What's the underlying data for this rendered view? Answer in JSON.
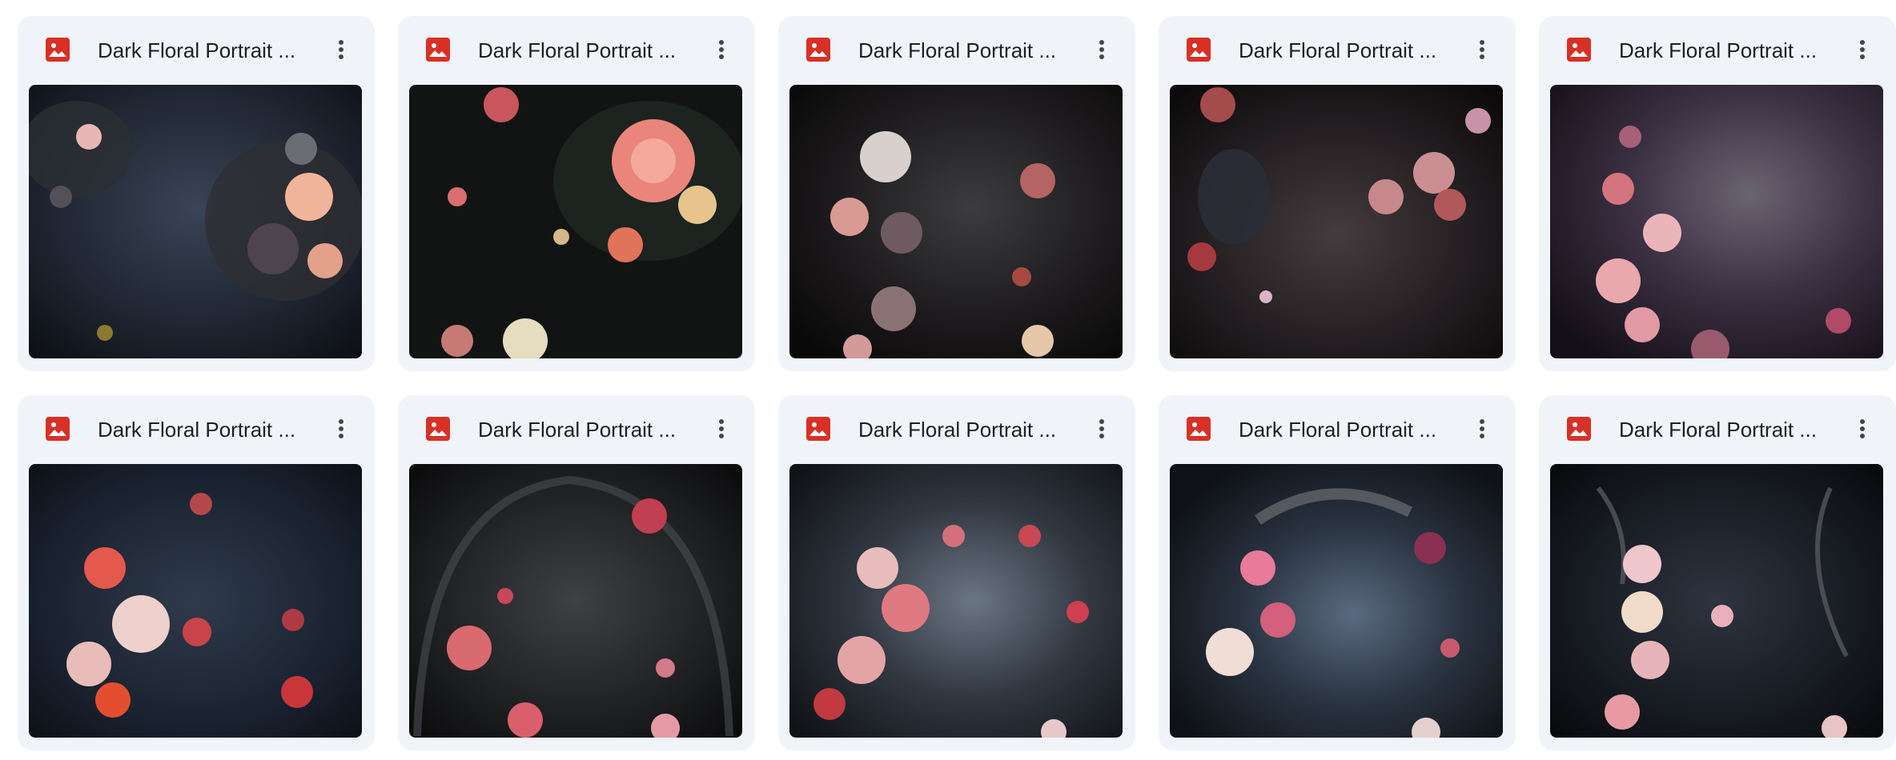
{
  "files": [
    {
      "title": "Dark Floral Portrait ...",
      "icon": "image-file-icon"
    },
    {
      "title": "Dark Floral Portrait ...",
      "icon": "image-file-icon"
    },
    {
      "title": "Dark Floral Portrait ...",
      "icon": "image-file-icon"
    },
    {
      "title": "Dark Floral Portrait ...",
      "icon": "image-file-icon"
    },
    {
      "title": "Dark Floral Portrait ...",
      "icon": "image-file-icon"
    },
    {
      "title": "Dark Floral Portrait ...",
      "icon": "image-file-icon"
    },
    {
      "title": "Dark Floral Portrait ...",
      "icon": "image-file-icon"
    },
    {
      "title": "Dark Floral Portrait ...",
      "icon": "image-file-icon"
    },
    {
      "title": "Dark Floral Portrait ...",
      "icon": "image-file-icon"
    },
    {
      "title": "Dark Floral Portrait ...",
      "icon": "image-file-icon"
    }
  ],
  "more_icon": "more-vert-icon",
  "colors": {
    "tile_bg": "#f0f4f9",
    "icon_red": "#d93025",
    "title_text": "#1f1f1f"
  }
}
